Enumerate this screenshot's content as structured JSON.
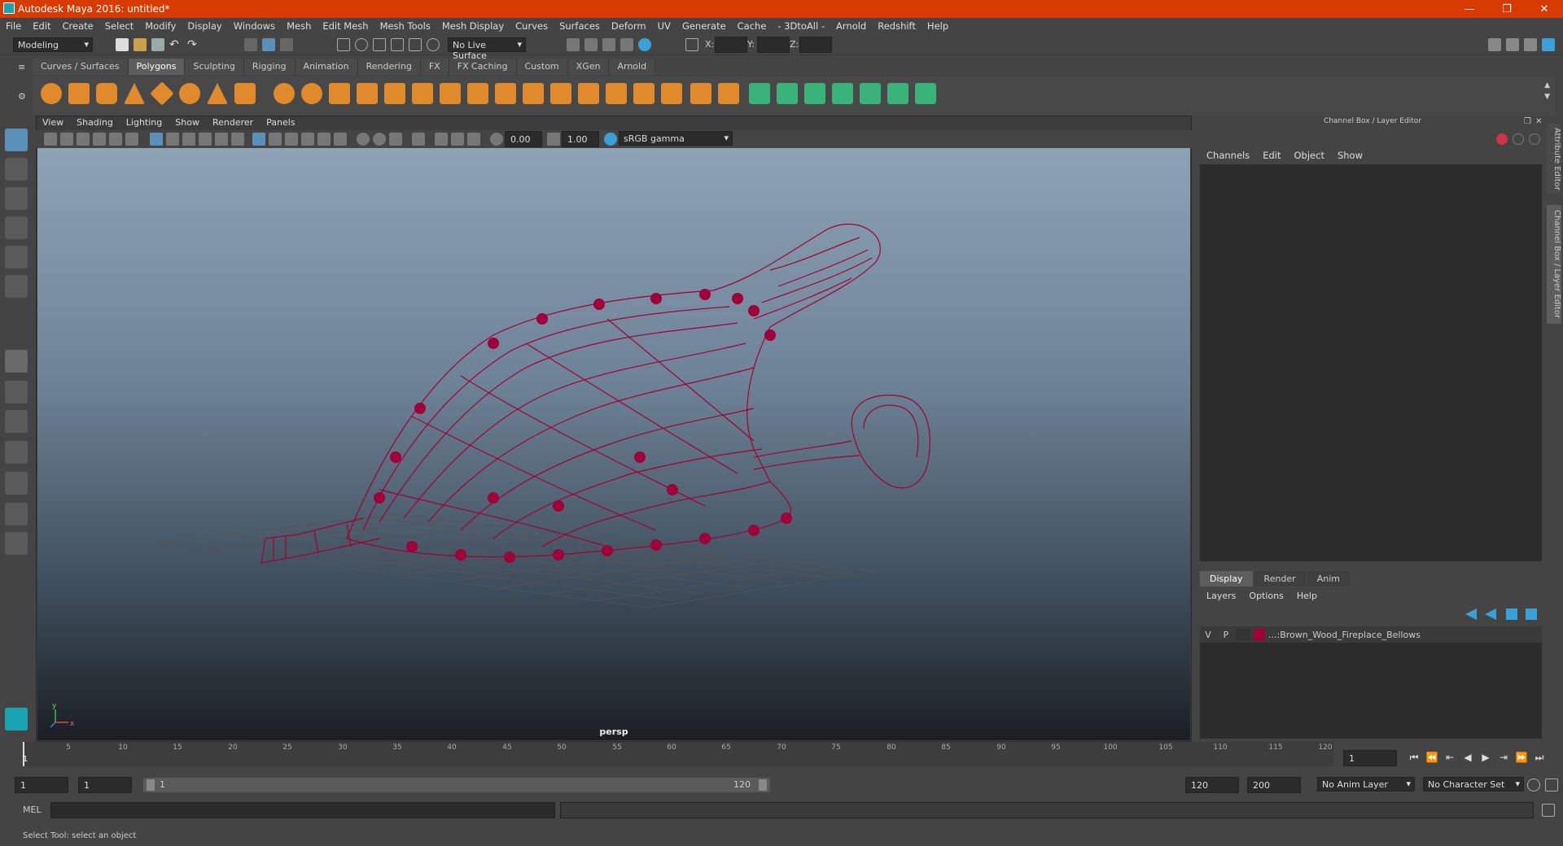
{
  "window": {
    "title": "Autodesk Maya 2016: untitled*",
    "minimize": "—",
    "maximize": "❐",
    "close": "✕"
  },
  "menubar": [
    "File",
    "Edit",
    "Create",
    "Select",
    "Modify",
    "Display",
    "Windows",
    "Mesh",
    "Edit Mesh",
    "Mesh Tools",
    "Mesh Display",
    "Curves",
    "Surfaces",
    "Deform",
    "UV",
    "Generate",
    "Cache",
    "- 3DtoAll -",
    "Arnold",
    "Redshift",
    "Help"
  ],
  "statusline": {
    "mode": "Modeling",
    "live_surface": "No Live Surface",
    "x_label": "X:",
    "y_label": "Y:",
    "z_label": "Z:"
  },
  "shelf_tabs": [
    "Curves / Surfaces",
    "Polygons",
    "Sculpting",
    "Rigging",
    "Animation",
    "Rendering",
    "FX",
    "FX Caching",
    "Custom",
    "XGen",
    "Arnold"
  ],
  "shelf_active": "Polygons",
  "panel_menu": [
    "View",
    "Shading",
    "Lighting",
    "Show",
    "Renderer",
    "Panels"
  ],
  "panel_toolbar": {
    "exposure": "0.00",
    "gamma": "1.00",
    "color_space": "sRGB gamma"
  },
  "viewport": {
    "camera": "persp",
    "axis_y": "y",
    "axis_x": "x"
  },
  "channel_box": {
    "title": "Channel Box / Layer Editor",
    "menu": [
      "Channels",
      "Edit",
      "Object",
      "Show"
    ]
  },
  "side_tabs": [
    "Attribute Editor",
    "Channel Box / Layer Editor"
  ],
  "layer_editor": {
    "tabs": [
      "Display",
      "Render",
      "Anim"
    ],
    "active_tab": "Display",
    "menu": [
      "Layers",
      "Options",
      "Help"
    ],
    "layers": [
      {
        "v": "V",
        "p": "P",
        "name": "...:Brown_Wood_Fireplace_Bellows",
        "color": "#a0003a"
      }
    ]
  },
  "timeline": {
    "ticks": [
      "5",
      "10",
      "15",
      "20",
      "25",
      "30",
      "35",
      "40",
      "45",
      "50",
      "55",
      "60",
      "65",
      "70",
      "75",
      "80",
      "85",
      "90",
      "95",
      "100",
      "105",
      "110",
      "115",
      "120"
    ],
    "current_frame_label": "1",
    "current_frame": "1"
  },
  "range": {
    "start": "1",
    "playback_start": "1",
    "range_min_label": "1",
    "range_max_label": "120",
    "playback_end": "120",
    "end": "200",
    "anim_layer": "No Anim Layer",
    "character_set": "No Character Set"
  },
  "cmdline": {
    "label": "MEL"
  },
  "helpline": "Select Tool: select an object",
  "colors": {
    "title_bar": "#d83b01",
    "wireframe": "#a0003a",
    "accent": "#1aa3b5"
  }
}
